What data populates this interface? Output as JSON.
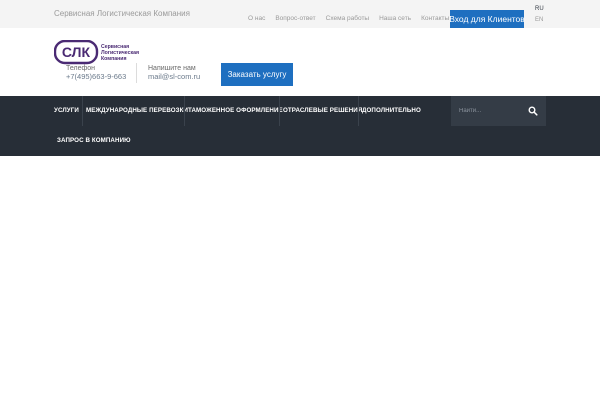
{
  "topbar": {
    "tagline": "Сервисная Логистическая Компания",
    "links": [
      "О нас",
      "Вопрос-ответ",
      "Схема работы",
      "Наша сеть",
      "Контакты"
    ],
    "client_button": "Вход для Клиентов",
    "lang_ru": "RU",
    "lang_en": "EN"
  },
  "header": {
    "logo_abbr": "СЛК",
    "logo_text": [
      "Сервисная",
      "Логистическая",
      "Компания"
    ],
    "phone_label": "Телефон",
    "phone_value": "+7(495)663-9-663",
    "mail_label": "Напишите нам",
    "mail_value": "mail@sl-com.ru",
    "order_button": "Заказать услугу"
  },
  "nav": {
    "items": [
      "УСЛУГИ",
      "МЕЖДУНАРОДНЫЕ ПЕРЕВОЗКИ",
      "ТАМОЖЕННОЕ ОФОРМЛЕНИЕ",
      "ОТРАСЛЕВЫЕ РЕШЕНИЯ",
      "ДОПОЛНИТЕЛЬНО",
      "ЗАПРОС В КОМПАНИЮ"
    ],
    "search_placeholder": "Найти...",
    "search_icon": "search-icon"
  },
  "colors": {
    "accent": "#1e6fc0",
    "navbar": "#272e37",
    "search_box": "#343c46",
    "logo": "#4a2a73",
    "topbar": "#f4f4f4"
  }
}
